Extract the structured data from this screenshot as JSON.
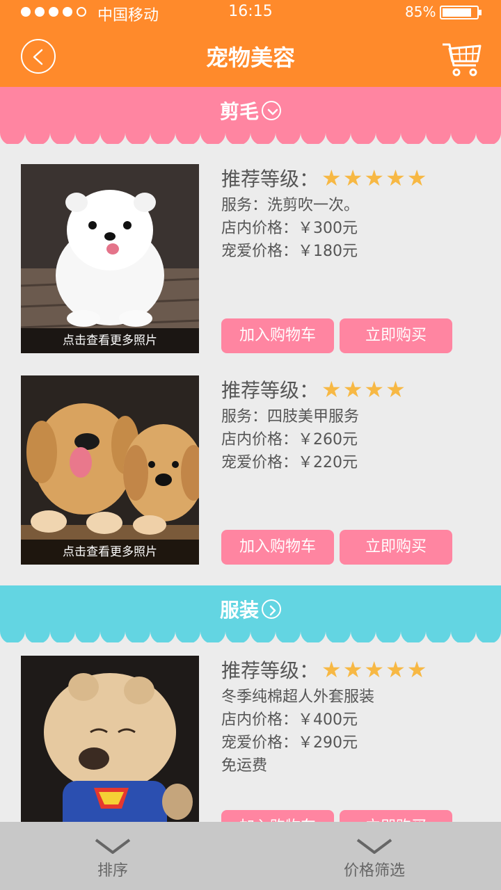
{
  "status_bar": {
    "carrier": "中国移动",
    "time": "16:15",
    "battery_percent": "85%",
    "battery_level": 0.85,
    "signal_bars": 4,
    "signal_total": 5
  },
  "header": {
    "title": "宠物美容",
    "back_icon": "chevron-left-icon",
    "cart_icon": "shopping-cart-icon"
  },
  "sections": [
    {
      "title": "剪毛",
      "icon": "chevron-down-circle-icon",
      "color": "#ff85a1"
    },
    {
      "title": "服装",
      "icon": "chevron-right-circle-icon",
      "color": "#63d5e2"
    }
  ],
  "products": [
    {
      "rating_label": "推荐等级：",
      "stars": 5,
      "lines": [
        "服务：洗剪吹一次。",
        "店内价格：￥300元",
        "宠爱价格：￥180元"
      ],
      "photo_caption": "点击查看更多照片",
      "add_cart_label": "加入购物车",
      "buy_label": "立即购买"
    },
    {
      "rating_label": "推荐等级：",
      "stars": 4,
      "lines": [
        "服务：四肢美甲服务",
        "店内价格：￥260元",
        "宠爱价格：￥220元"
      ],
      "photo_caption": "点击查看更多照片",
      "add_cart_label": "加入购物车",
      "buy_label": "立即购买"
    },
    {
      "rating_label": "推荐等级：",
      "stars": 5,
      "lines": [
        "冬季纯棉超人外套服装",
        "店内价格：￥400元",
        "宠爱价格：￥290元",
        "免运费"
      ],
      "photo_caption": "",
      "add_cart_label": "加入购物车",
      "buy_label": "立即购买"
    }
  ],
  "bottom_bar": {
    "sort_label": "排序",
    "price_filter_label": "价格筛选"
  },
  "colors": {
    "header": "#ff8a2b",
    "accent_pink": "#ff85a1",
    "accent_cyan": "#63d5e2",
    "star": "#f7b844"
  }
}
